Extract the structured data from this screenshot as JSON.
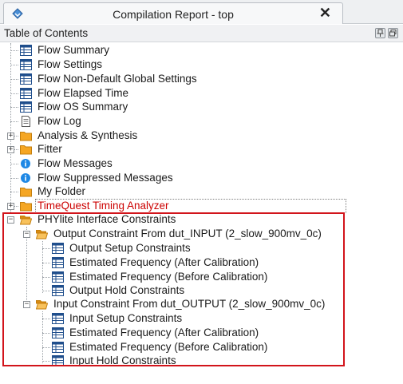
{
  "window": {
    "tab_title": "Compilation Report - top",
    "close_glyph": "✕"
  },
  "toc": {
    "title": "Table of Contents"
  },
  "items": [
    {
      "label": "Flow Summary",
      "icon": "table-icon"
    },
    {
      "label": "Flow Settings",
      "icon": "table-icon"
    },
    {
      "label": "Flow Non-Default Global Settings",
      "icon": "table-icon"
    },
    {
      "label": "Flow Elapsed Time",
      "icon": "table-icon"
    },
    {
      "label": "Flow OS Summary",
      "icon": "table-icon"
    },
    {
      "label": "Flow Log",
      "icon": "document-icon"
    },
    {
      "label": "Analysis & Synthesis",
      "icon": "folder-icon"
    },
    {
      "label": "Fitter",
      "icon": "folder-icon"
    },
    {
      "label": "Flow Messages",
      "icon": "info-icon"
    },
    {
      "label": "Flow Suppressed Messages",
      "icon": "info-icon"
    },
    {
      "label": "My Folder",
      "icon": "folder-icon"
    },
    {
      "label": "TimeQuest Timing Analyzer",
      "icon": "folder-icon"
    },
    {
      "label": "PHYlite Interface Constraints",
      "icon": "open-folder-icon"
    },
    {
      "label": "Output Constraint From dut_INPUT (2_slow_900mv_0c)",
      "icon": "open-folder-icon"
    },
    {
      "label": "Output Setup Constraints",
      "icon": "table-icon"
    },
    {
      "label": "Estimated Frequency (After Calibration)",
      "icon": "table-icon"
    },
    {
      "label": "Estimated Frequency (Before Calibration)",
      "icon": "table-icon"
    },
    {
      "label": "Output Hold Constraints",
      "icon": "table-icon"
    },
    {
      "label": "Input Constraint From dut_OUTPUT (2_slow_900mv_0c)",
      "icon": "open-folder-icon"
    },
    {
      "label": "Input Setup Constraints",
      "icon": "table-icon"
    },
    {
      "label": "Estimated Frequency (After Calibration)",
      "icon": "table-icon"
    },
    {
      "label": "Estimated Frequency (Before Calibration)",
      "icon": "table-icon"
    },
    {
      "label": "Input Hold Constraints",
      "icon": "table-icon"
    }
  ],
  "colors": {
    "highlight_border": "#d2141b",
    "timequest_text": "#cc0000",
    "folder": "#f5a623",
    "info": "#1e88e5",
    "table_header": "#1f4e8c"
  }
}
